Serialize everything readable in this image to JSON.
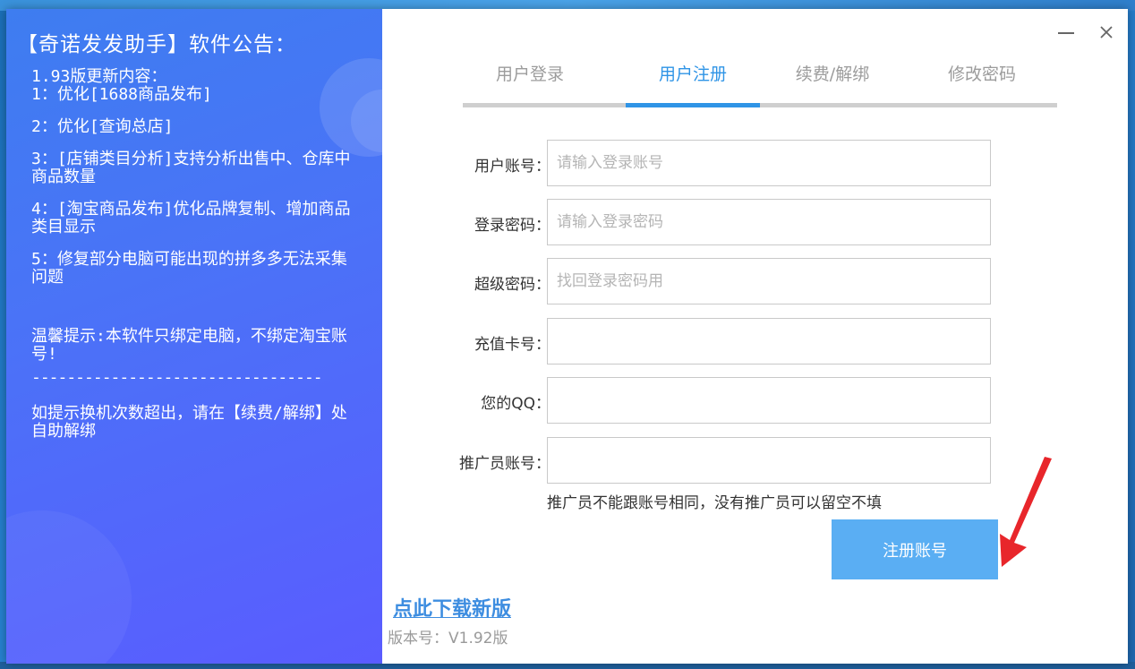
{
  "announcement": {
    "title": "【奇诺发发助手】软件公告：",
    "paragraphs": [
      "1.93版更新内容：\n1：优化[1688商品发布]",
      "2：优化[查询总店]",
      "3：[店铺类目分析]支持分析出售中、仓库中商品数量",
      "4：[淘宝商品发布]优化品牌复制、增加商品类目显示",
      "5：修复部分电脑可能出现的拼多多无法采集问题"
    ],
    "tip": "温馨提示:本软件只绑定电脑，不绑定淘宝账号!",
    "divider": "---------------------------------",
    "unbind_tip": "如提示换机次数超出，请在【续费/解绑】处自助解绑"
  },
  "tabs": [
    {
      "label": "用户登录"
    },
    {
      "label": "用户注册"
    },
    {
      "label": "续费/解绑"
    },
    {
      "label": "修改密码"
    }
  ],
  "form": {
    "fields": [
      {
        "label": "用户账号：",
        "placeholder": "请输入登录账号",
        "value": ""
      },
      {
        "label": "登录密码：",
        "placeholder": "请输入登录密码",
        "value": ""
      },
      {
        "label": "超级密码：",
        "placeholder": "找回登录密码用",
        "value": ""
      },
      {
        "label": "充值卡号：",
        "placeholder": "",
        "value": ""
      },
      {
        "label": "您的QQ：",
        "placeholder": "",
        "value": ""
      },
      {
        "label": "推广员账号：",
        "placeholder": "",
        "value": ""
      }
    ],
    "hint": "推广员不能跟账号相同，没有推广员可以留空不填",
    "submit_label": "注册账号"
  },
  "footer": {
    "link_text": "点此下载新版",
    "version": "版本号：V1.92版"
  },
  "colors": {
    "accent": "#2f94e6",
    "button": "#5aaef3",
    "arrow": "#e8262b",
    "panel_start": "#3e7df0",
    "panel_end": "#5a5cff"
  },
  "icons": {
    "minimize": "minimize-icon",
    "close": "close-icon"
  }
}
